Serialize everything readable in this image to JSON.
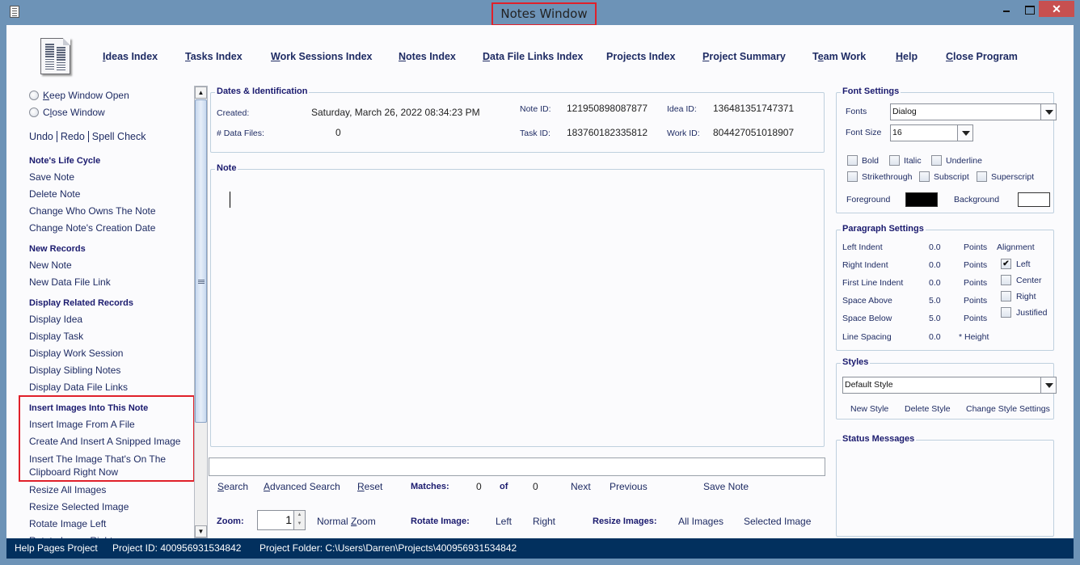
{
  "window": {
    "title": "Notes Window",
    "minimize_label": "",
    "maximize_label": "",
    "close_label": "✕"
  },
  "nav": {
    "items": [
      {
        "mnemonic": "I",
        "rest": "deas Index"
      },
      {
        "mnemonic": "T",
        "rest": "asks Index"
      },
      {
        "mnemonic": "W",
        "rest": "ork Sessions Index"
      },
      {
        "mnemonic": "N",
        "rest": "otes Index"
      },
      {
        "mnemonic": "D",
        "rest": "ata File Links Index"
      },
      {
        "mnemonic": "",
        "rest": "Projects Index"
      },
      {
        "mnemonic": "P",
        "rest": "roject Summary"
      },
      {
        "pre": "T",
        "mnemonic": "e",
        "rest": "am Work"
      },
      {
        "mnemonic": "H",
        "rest": "elp"
      },
      {
        "mnemonic": "C",
        "rest": "lose Program"
      }
    ]
  },
  "sidebar": {
    "keep_open": {
      "mnemonic": "K",
      "rest": "eep Window Open"
    },
    "close_window": {
      "pre": "C",
      "mnemonic": "l",
      "rest": "ose Window"
    },
    "undo": "Undo",
    "redo": "Redo",
    "spell_check": "Spell Check",
    "sections": [
      {
        "heading": "Note's Life Cycle",
        "items": [
          "Save Note",
          "Delete Note",
          "Change Who Owns The Note",
          "Change Note's Creation Date"
        ]
      },
      {
        "heading": "New Records",
        "items": [
          "New Note",
          "New Data File Link"
        ]
      },
      {
        "heading": "Display Related Records",
        "items": [
          "Display Idea",
          "Display Task",
          "Display Work Session",
          "Display Sibling Notes",
          "Display Data File Links"
        ]
      },
      {
        "heading": "Insert Images Into This Note",
        "items": [
          "Insert Image From A File",
          "Create And Insert A Snipped Image",
          "Insert The Image That's On The",
          "Clipboard Right Now"
        ]
      },
      {
        "heading": "",
        "items": [
          "Resize All Images",
          "Resize Selected Image",
          "Rotate Image Left",
          "Rotate Image Right"
        ]
      }
    ]
  },
  "dates": {
    "title": "Dates & Identification",
    "created_label": "Created:",
    "created_value": "Saturday, March 26, 2022   08:34:23 PM",
    "data_files_label": "# Data Files:",
    "data_files_value": "0",
    "note_id_label": "Note ID:",
    "note_id_value": "121950898087877",
    "idea_id_label": "Idea ID:",
    "idea_id_value": "136481351747371",
    "task_id_label": "Task ID:",
    "task_id_value": "183760182335812",
    "work_id_label": "Work ID:",
    "work_id_value": "804427051018907"
  },
  "note": {
    "title": "Note",
    "content": ""
  },
  "search": {
    "value": "",
    "search_label": {
      "mnemonic": "S",
      "rest": "earch"
    },
    "advanced_label": {
      "mnemonic": "A",
      "rest": "dvanced Search"
    },
    "reset_label": {
      "mnemonic": "R",
      "rest": "eset"
    },
    "matches_label": "Matches:",
    "matches_value": "0",
    "of_label": "of",
    "total_value": "0",
    "next_label": "Next",
    "previous_label": "Previous",
    "save_note_label": "Save Note"
  },
  "bottom": {
    "zoom_label": "Zoom:",
    "zoom_value": "1",
    "normal_zoom": {
      "pre": "Normal ",
      "mnemonic": "Z",
      "rest": "oom"
    },
    "rotate_label": "Rotate Image:",
    "rotate_left": "Left",
    "rotate_right": "Right",
    "resize_label": "Resize Images:",
    "resize_all": "All Images",
    "resize_selected": "Selected Image"
  },
  "font_settings": {
    "title": "Font Settings",
    "fonts_label": "Fonts",
    "font_value": "Dialog",
    "size_label": "Font Size",
    "size_value": "16",
    "bold": "Bold",
    "italic": "Italic",
    "underline": "Underline",
    "strikethrough": "Strikethrough",
    "subscript": "Subscript",
    "superscript": "Superscript",
    "foreground_label": "Foreground",
    "background_label": "Background",
    "foreground_color": "#000000",
    "background_color": "#ffffff"
  },
  "paragraph": {
    "title": "Paragraph Settings",
    "rows": [
      {
        "label": "Left Indent",
        "value": "0.0",
        "unit": "Points"
      },
      {
        "label": "Right Indent",
        "value": "0.0",
        "unit": "Points"
      },
      {
        "label": "First Line Indent",
        "value": "0.0",
        "unit": "Points"
      },
      {
        "label": "Space Above",
        "value": "5.0",
        "unit": "Points"
      },
      {
        "label": "Space Below",
        "value": "5.0",
        "unit": "Points"
      },
      {
        "label": "Line Spacing",
        "value": "0.0",
        "unit": "* Height"
      }
    ],
    "alignment_label": "Alignment",
    "alignments": [
      {
        "label": "Left",
        "checked": true
      },
      {
        "label": "Center",
        "checked": false
      },
      {
        "label": "Right",
        "checked": false
      },
      {
        "label": "Justified",
        "checked": false
      }
    ]
  },
  "styles": {
    "title": "Styles",
    "selected": "Default Style",
    "new_style": "New Style",
    "delete_style": "Delete Style",
    "change_settings": "Change Style Settings"
  },
  "status_messages": {
    "title": "Status Messages",
    "text": ""
  },
  "statusbar": {
    "project_name": "Help Pages Project",
    "project_id": "Project ID:  400956931534842",
    "project_folder": "Project Folder: C:\\Users\\Darren\\Projects\\400956931534842"
  },
  "colors": {
    "titlebar": "#6d93b7",
    "statusbar": "#02305e",
    "link_text": "#1e2b63",
    "highlight_red": "#e0202a",
    "close_button": "#c75050"
  }
}
